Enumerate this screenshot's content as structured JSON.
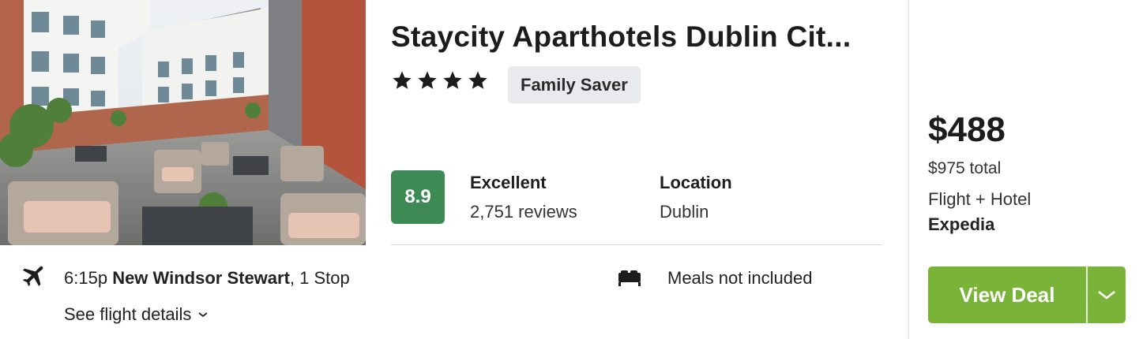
{
  "hotel": {
    "name": "Staycity Aparthotels Dublin Cit...",
    "star_rating": 4,
    "tag": "Family Saver",
    "photo_alt": "courtyard-terrace-photo"
  },
  "rating": {
    "score": "8.9",
    "label": "Excellent",
    "reviews": "2,751 reviews",
    "score_color": "#3d8a55"
  },
  "location": {
    "label": "Location",
    "value": "Dublin"
  },
  "flight": {
    "time": "6:15p",
    "airport": "New Windsor Stewart",
    "stops": ", 1 Stop",
    "details_link": "See flight details",
    "icon": "airplane-icon"
  },
  "meals": {
    "text": "Meals not included",
    "icon": "bed-icon"
  },
  "pricing": {
    "price": "$488",
    "total": "$975 total",
    "package": "Flight + Hotel",
    "provider": "Expedia"
  },
  "deal_button": {
    "label": "View Deal",
    "color": "#79b338"
  }
}
